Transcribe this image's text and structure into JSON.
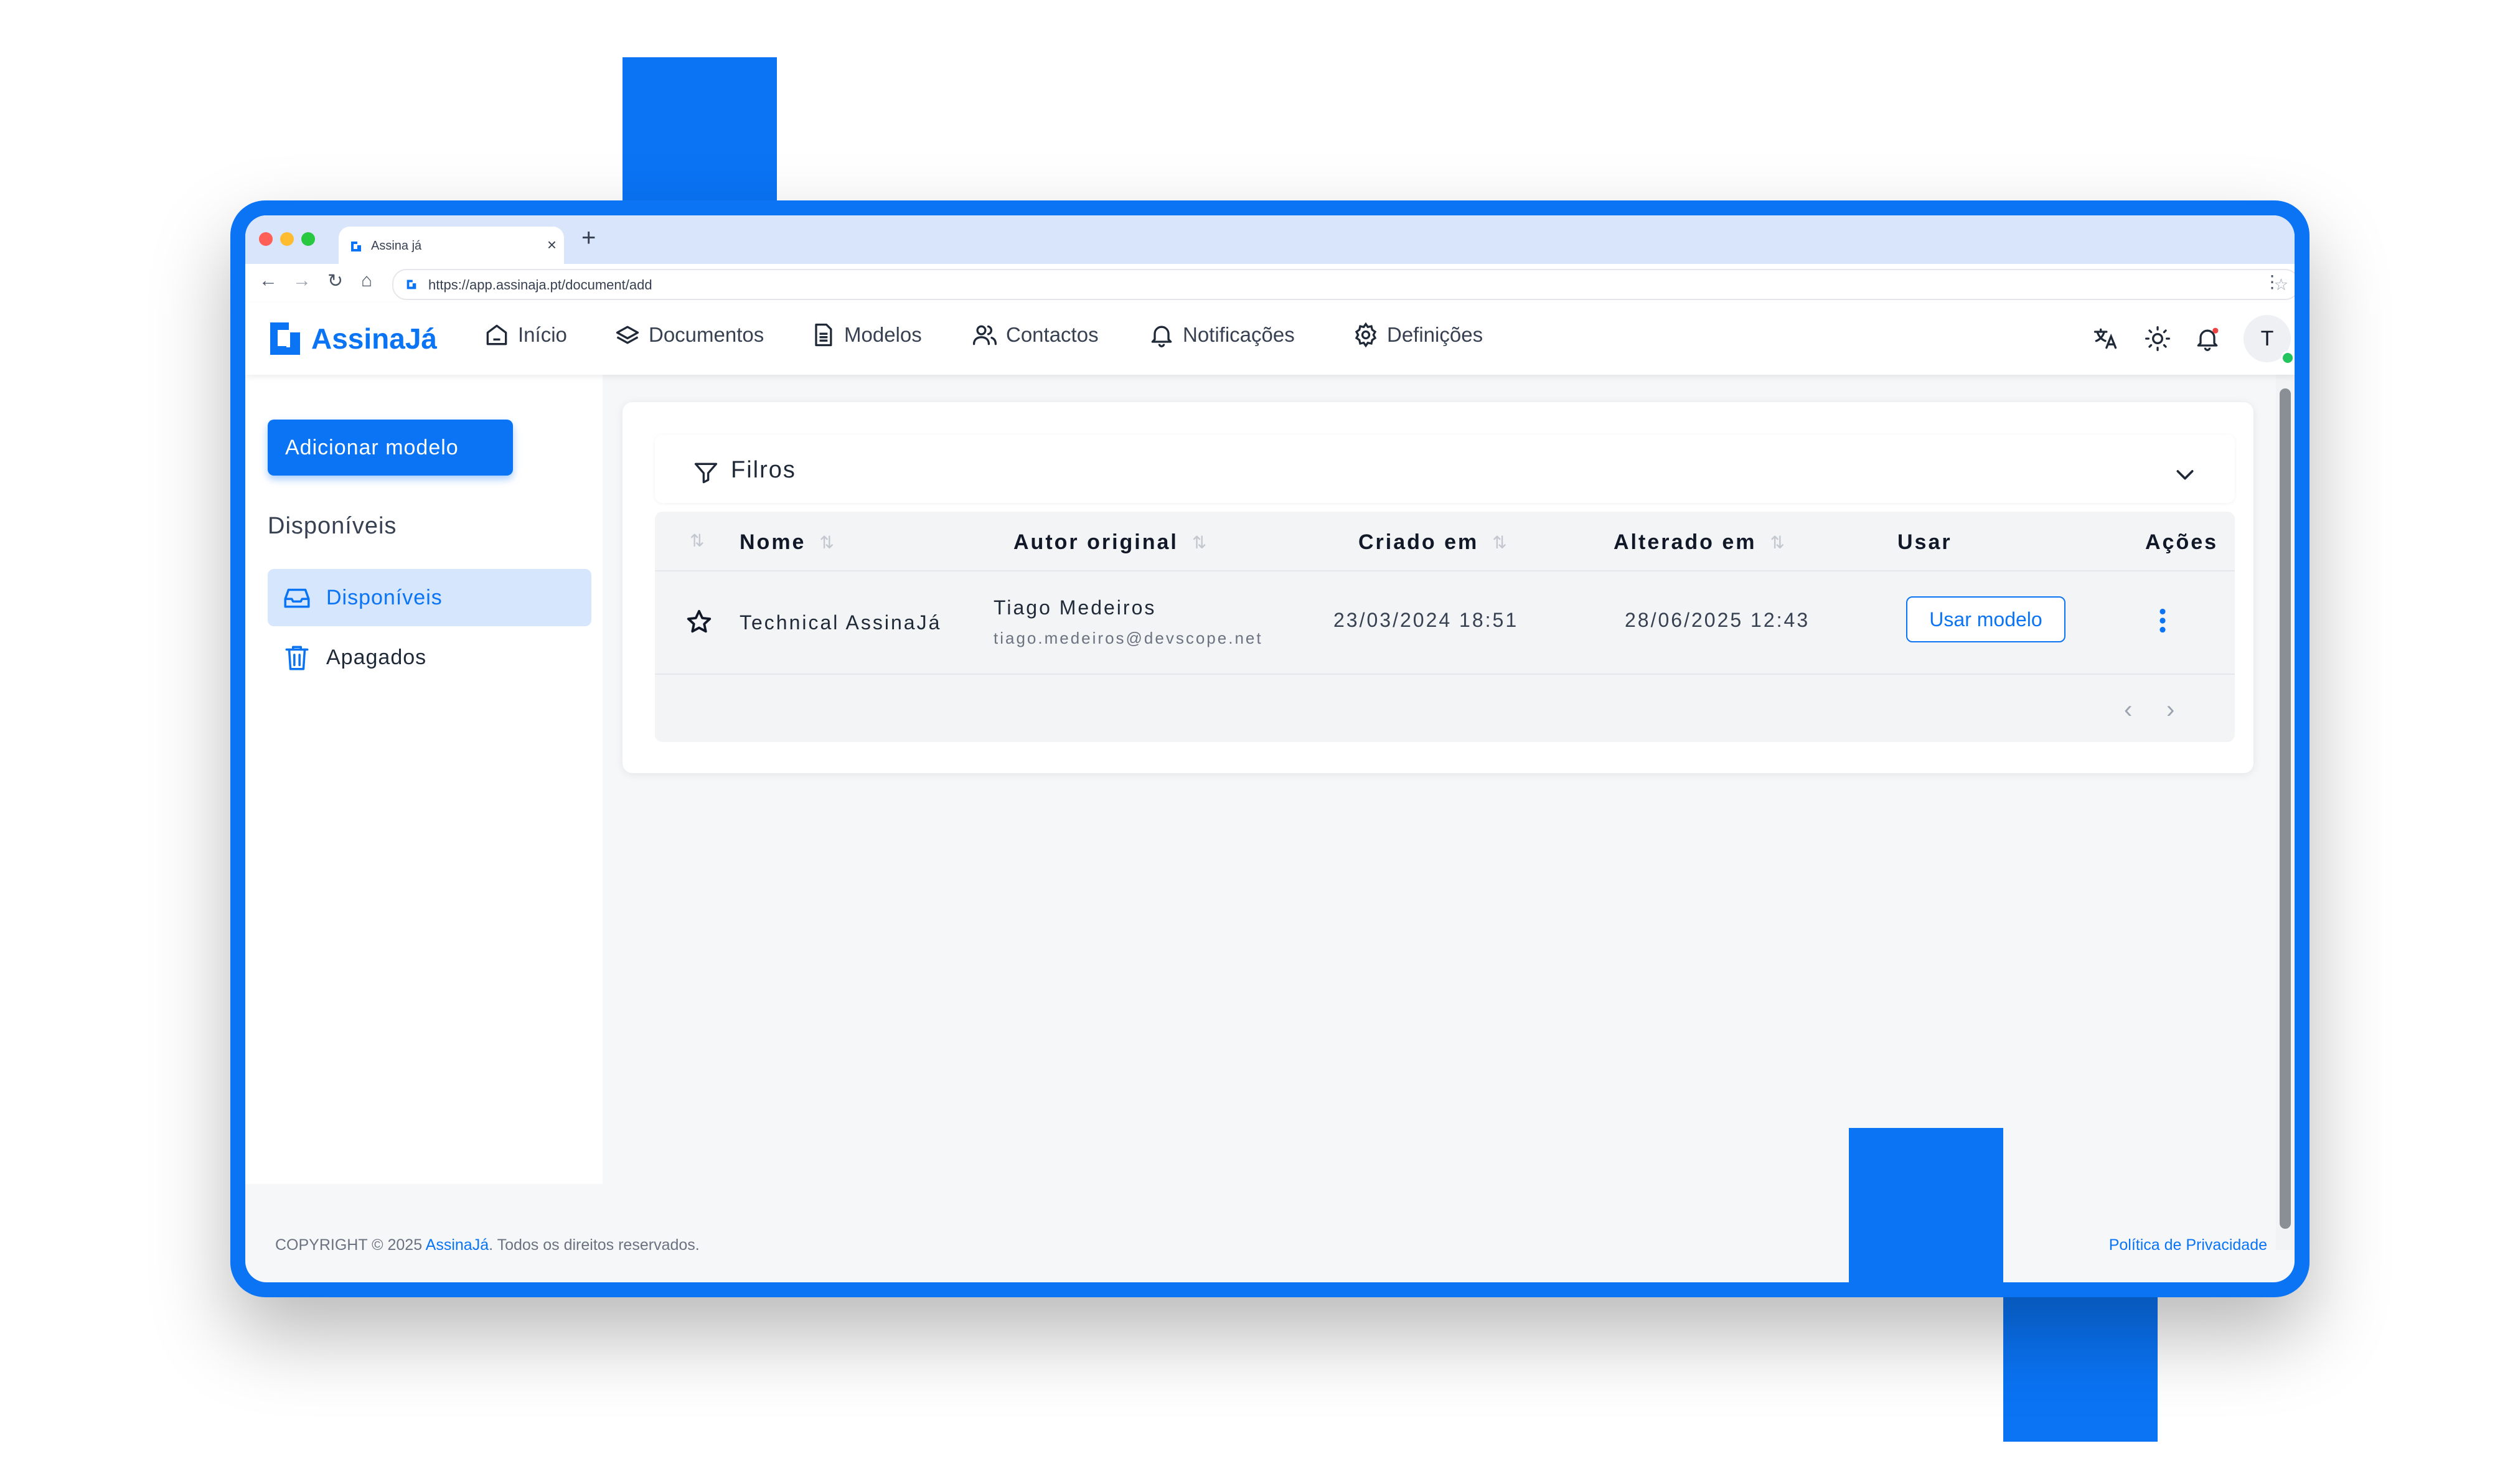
{
  "browser": {
    "tab_title": "Assina já",
    "new_tab": "+",
    "url": "https://app.assinaja.pt/document/add",
    "window_dots": [
      "#ff5f57",
      "#febc2e",
      "#28c840"
    ]
  },
  "app": {
    "brand": "AssinaJá",
    "accent_color": "#0a74f5",
    "nav": [
      {
        "label": "Início",
        "icon": "home-icon"
      },
      {
        "label": "Documentos",
        "icon": "layers-icon"
      },
      {
        "label": "Modelos",
        "icon": "document-icon"
      },
      {
        "label": "Contactos",
        "icon": "users-icon"
      },
      {
        "label": "Notificações",
        "icon": "bell-icon"
      },
      {
        "label": "Definições",
        "icon": "gear-icon"
      }
    ],
    "header_icons": [
      "translate-icon",
      "sun-icon",
      "notification-bell-icon"
    ],
    "avatar_initial": "T"
  },
  "sidebar": {
    "add_button": "Adicionar modelo",
    "heading": "Disponíveis",
    "items": [
      {
        "label": "Disponíveis",
        "icon": "inbox-icon",
        "active": true
      },
      {
        "label": "Apagados",
        "icon": "trash-icon",
        "active": false
      }
    ]
  },
  "filters": {
    "label": "Filros"
  },
  "table": {
    "columns": [
      "Nome",
      "Autor original",
      "Criado em",
      "Alterado em",
      "Usar",
      "Ações"
    ],
    "rows": [
      {
        "name": "Technical AssinaJá",
        "author_name": "Tiago Medeiros",
        "author_email": "tiago.medeiros@devscope.net",
        "created": "23/03/2024 18:51",
        "modified": "28/06/2025 12:43",
        "use_button": "Usar modelo"
      }
    ]
  },
  "footer": {
    "copyright_prefix": "COPYRIGHT © 2025 ",
    "copyright_brand": "AssinaJá",
    "copyright_suffix": ". Todos os direitos reservados.",
    "privacy": "Política de Privacidade"
  }
}
